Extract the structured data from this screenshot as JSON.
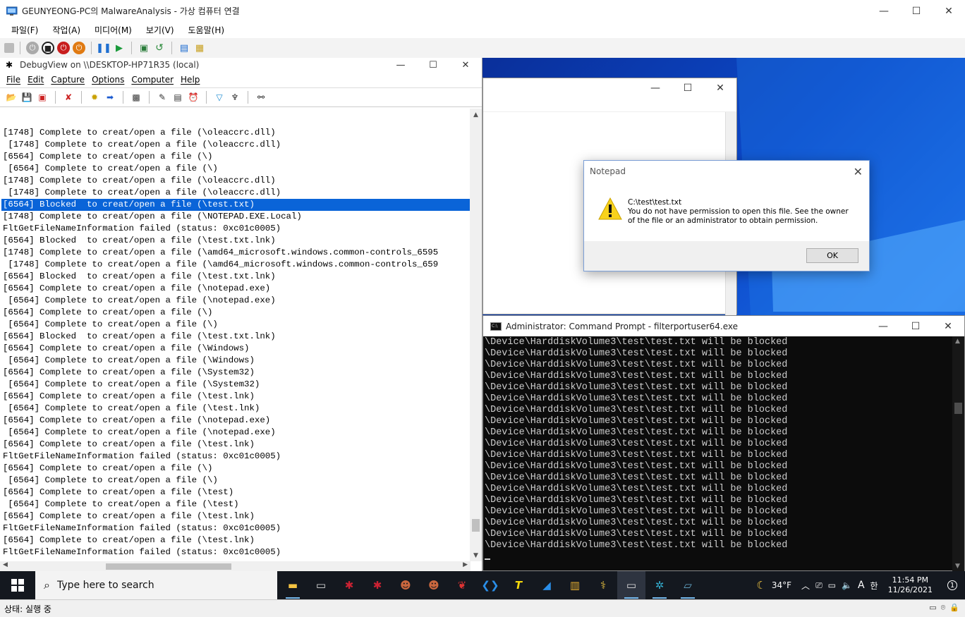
{
  "host": {
    "title": "GEUNYEONG-PC의 MalwareAnalysis - 가상 컴퓨터 연결",
    "menu": [
      "파일(F)",
      "작업(A)",
      "미디어(M)",
      "보기(V)",
      "도움말(H)"
    ],
    "status": "상태: 실행 중"
  },
  "debugview": {
    "title": "DebugView on \\\\DESKTOP-HP71R35 (local)",
    "menu": [
      "File",
      "Edit",
      "Capture",
      "Options",
      "Computer",
      "Help"
    ],
    "lines": [
      "[1748] Complete to creat/open a file (\\oleaccrc.dll)",
      " [1748] Complete to creat/open a file (\\oleaccrc.dll)",
      "[6564] Complete to creat/open a file (\\)",
      " [6564] Complete to creat/open a file (\\)",
      "[1748] Complete to creat/open a file (\\oleaccrc.dll)",
      " [1748] Complete to creat/open a file (\\oleaccrc.dll)",
      "[6564] Blocked  to creat/open a file (\\test.txt)",
      "[1748] Complete to creat/open a file (\\NOTEPAD.EXE.Local)",
      "FltGetFileNameInformation failed (status: 0xc01c0005)",
      "[6564] Blocked  to creat/open a file (\\test.txt.lnk)",
      "[1748] Complete to creat/open a file (\\amd64_microsoft.windows.common-controls_6595",
      " [1748] Complete to creat/open a file (\\amd64_microsoft.windows.common-controls_659",
      "[6564] Blocked  to creat/open a file (\\test.txt.lnk)",
      "[6564] Complete to creat/open a file (\\notepad.exe)",
      " [6564] Complete to creat/open a file (\\notepad.exe)",
      "[6564] Complete to creat/open a file (\\)",
      " [6564] Complete to creat/open a file (\\)",
      "[6564] Blocked  to creat/open a file (\\test.txt.lnk)",
      "[6564] Complete to creat/open a file (\\Windows)",
      " [6564] Complete to creat/open a file (\\Windows)",
      "[6564] Complete to creat/open a file (\\System32)",
      " [6564] Complete to creat/open a file (\\System32)",
      "[6564] Complete to creat/open a file (\\test.lnk)",
      " [6564] Complete to creat/open a file (\\test.lnk)",
      "[6564] Complete to creat/open a file (\\notepad.exe)",
      " [6564] Complete to creat/open a file (\\notepad.exe)",
      "[6564] Complete to creat/open a file (\\test.lnk)",
      "FltGetFileNameInformation failed (status: 0xc01c0005)",
      "[6564] Complete to creat/open a file (\\)",
      " [6564] Complete to creat/open a file (\\)",
      "[6564] Complete to creat/open a file (\\test)",
      " [6564] Complete to creat/open a file (\\test)",
      "[6564] Complete to creat/open a file (\\test.lnk)",
      "FltGetFileNameInformation failed (status: 0xc01c0005)",
      "[6564] Complete to creat/open a file (\\test.lnk)",
      "FltGetFileNameInformation failed (status: 0xc01c0005)"
    ],
    "selected_index": 6
  },
  "dialog": {
    "title": "Notepad",
    "path": "C:\\test\\test.txt",
    "message_line1": "You do not have permission to open this file.  See the owner",
    "message_line2": "of the file or an administrator to obtain permission.",
    "ok_label": "OK"
  },
  "cmd": {
    "title": "Administrator: Command Prompt - filterportuser64.exe",
    "line": "\\Device\\HarddiskVolume3\\test\\test.txt will be blocked",
    "repeat": 19
  },
  "taskbar": {
    "search_placeholder": "Type here to search",
    "temperature": "34°F",
    "time": "11:54 PM",
    "date": "11/26/2021",
    "ime": "A",
    "ime2": "한",
    "notifications": "1"
  }
}
